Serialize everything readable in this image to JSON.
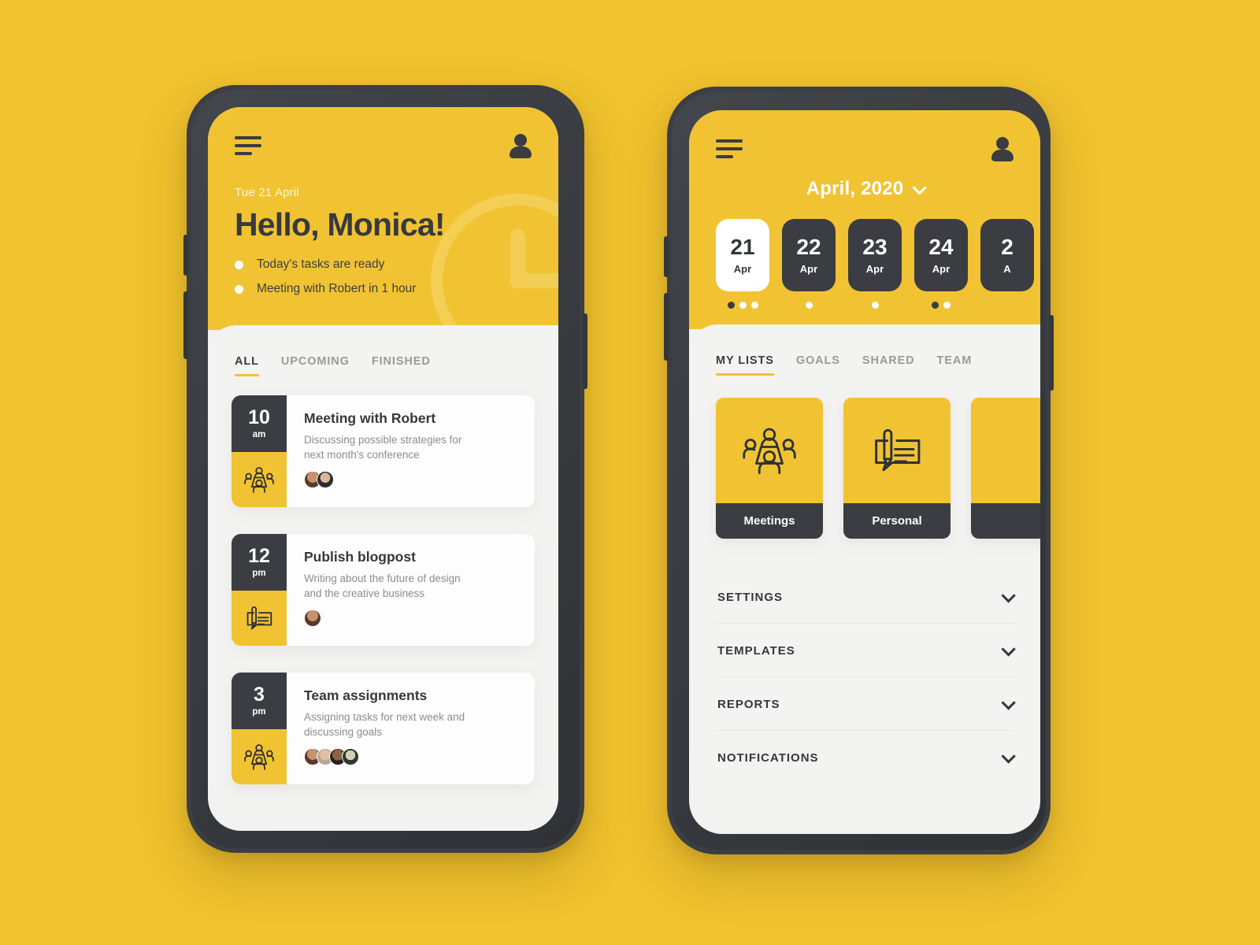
{
  "theme": {
    "background": "#f0c22e",
    "accent": "#f1c333",
    "dark": "#3b3d42",
    "panel": "#f3f3f2",
    "card": "#fdfdfd"
  },
  "left_phone": {
    "topbar": {
      "menu_icon": "hamburger-icon",
      "profile_icon": "person-icon"
    },
    "header": {
      "date": "Tue 21 April",
      "greeting": "Hello, Monica!",
      "notes": [
        "Today's tasks are ready",
        "Meeting with Robert in 1 hour"
      ]
    },
    "tabs": [
      {
        "label": "ALL",
        "active": true
      },
      {
        "label": "UPCOMING",
        "active": false
      },
      {
        "label": "FINISHED",
        "active": false
      }
    ],
    "tasks": [
      {
        "hour": "10",
        "meridiem": "am",
        "title": "Meeting with Robert",
        "description": "Discussing possible strategies for next month's conference",
        "icon": "meeting-people-icon",
        "attendees": 2
      },
      {
        "hour": "12",
        "meridiem": "pm",
        "title": "Publish blogpost",
        "description": "Writing about the future of design and the creative business",
        "icon": "pen-note-icon",
        "attendees": 1
      },
      {
        "hour": "3",
        "meridiem": "pm",
        "title": "Team assignments",
        "description": "Assigning tasks for next week and discussing goals",
        "icon": "meeting-people-icon",
        "attendees": 4
      }
    ]
  },
  "right_phone": {
    "topbar": {
      "menu_icon": "hamburger-icon",
      "profile_icon": "person-icon"
    },
    "month_selector": {
      "label": "April, 2020",
      "icon": "chevron-down-icon"
    },
    "dates": [
      {
        "day": "21",
        "month": "Apr",
        "selected": true,
        "dots": [
          "dark",
          "light",
          "light"
        ]
      },
      {
        "day": "22",
        "month": "Apr",
        "selected": false,
        "dots": [
          "light"
        ]
      },
      {
        "day": "23",
        "month": "Apr",
        "selected": false,
        "dots": [
          "light"
        ]
      },
      {
        "day": "24",
        "month": "Apr",
        "selected": false,
        "dots": [
          "dark",
          "light"
        ]
      },
      {
        "day": "2",
        "month": "A",
        "selected": false,
        "dots": []
      }
    ],
    "tabs": [
      {
        "label": "MY LISTS",
        "active": true
      },
      {
        "label": "GOALS",
        "active": false
      },
      {
        "label": "SHARED",
        "active": false
      },
      {
        "label": "TEAM",
        "active": false
      }
    ],
    "lists": [
      {
        "caption": "Meetings",
        "icon": "meeting-people-icon"
      },
      {
        "caption": "Personal",
        "icon": "pen-note-icon"
      },
      {
        "caption": "",
        "icon": ""
      }
    ],
    "menu": [
      {
        "label": "SETTINGS",
        "icon": "chevron-down-icon"
      },
      {
        "label": "TEMPLATES",
        "icon": "chevron-down-icon"
      },
      {
        "label": "REPORTS",
        "icon": "chevron-down-icon"
      },
      {
        "label": "NOTIFICATIONS",
        "icon": "chevron-down-icon"
      }
    ]
  }
}
